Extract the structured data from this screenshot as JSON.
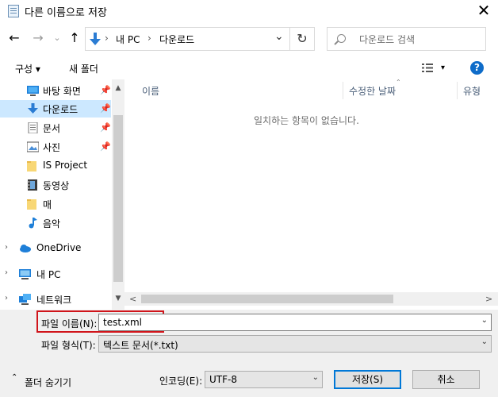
{
  "window": {
    "title": "다른 이름으로 저장",
    "close_glyph": "✕"
  },
  "nav": {
    "back_glyph": "←",
    "forward_glyph": "→",
    "recent_glyph": "⌄",
    "up_glyph": "↑",
    "breadcrumb": [
      "내 PC",
      "다운로드"
    ],
    "crumb_sep": "›",
    "addr_dropdown": "⌄",
    "refresh_glyph": "↻"
  },
  "search": {
    "placeholder": "다운로드 검색"
  },
  "toolbar": {
    "organize": "구성 ▾",
    "new_folder": "새 폴더",
    "view_dropdown": "▾",
    "help": "?"
  },
  "sidebar": {
    "items": [
      {
        "label": "바탕 화면",
        "icon": "desktop-icon",
        "pinned": true
      },
      {
        "label": "다운로드",
        "icon": "download-icon",
        "pinned": true,
        "selected": true
      },
      {
        "label": "문서",
        "icon": "document-icon",
        "pinned": true
      },
      {
        "label": "사진",
        "icon": "pictures-icon",
        "pinned": true
      },
      {
        "label": "IS Project",
        "icon": "folder-icon"
      },
      {
        "label": "동영상",
        "icon": "video-icon"
      },
      {
        "label": "매",
        "icon": "folder-icon"
      },
      {
        "label": "음악",
        "icon": "music-icon"
      },
      {
        "label": "OneDrive",
        "icon": "onedrive-icon"
      },
      {
        "label": "내 PC",
        "icon": "pc-icon"
      },
      {
        "label": "네트워크",
        "icon": "network-icon"
      }
    ],
    "pin_glyph": "📌",
    "expand_glyph": "›",
    "scroll_up": "▲",
    "scroll_down": "▼"
  },
  "file_list": {
    "columns": [
      "이름",
      "수정한 날짜",
      "유형"
    ],
    "empty_message": "일치하는 항목이 없습니다.",
    "scroll_left": "<",
    "scroll_right": ">",
    "sort_glyph": "⌃"
  },
  "save": {
    "filename_label": "파일 이름(N):",
    "filename_value": "test.xml",
    "filetype_label": "파일 형식(T):",
    "filetype_value": "텍스트 문서(*.txt)",
    "encoding_label": "인코딩(E):",
    "encoding_value": "UTF-8",
    "save_button": "저장(S)",
    "cancel_button": "취소",
    "hide_folders": "폴더 숨기기",
    "hide_folders_glyph": "⌃",
    "dropdown_glyph": "⌄"
  },
  "colors": {
    "accent": "#0078d7",
    "selection": "#cce8ff",
    "highlight_box": "#d0141a"
  }
}
